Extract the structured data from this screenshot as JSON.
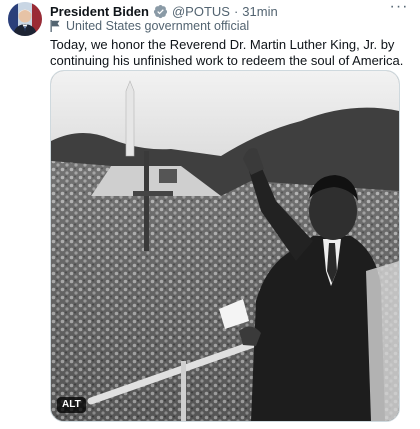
{
  "tweet": {
    "author_name": "President Biden",
    "handle": "@POTUS",
    "separator": "·",
    "time": "31min",
    "affiliation": "United States government official",
    "text": "Today, we honor the Reverend Dr. Martin Luther King, Jr. by continuing his unfinished work to redeem the soul of America.",
    "more_label": "···",
    "alt_label": "ALT"
  },
  "icons": {
    "verified": "verified-badge-icon",
    "affiliation": "flag-icon",
    "more": "more-icon"
  },
  "colors": {
    "verified_blue": "#1d9bf0",
    "secondary_text": "#536471"
  }
}
